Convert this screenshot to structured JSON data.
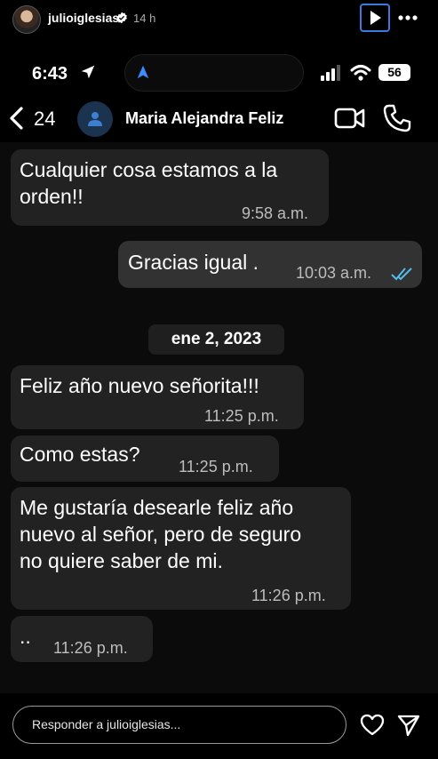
{
  "story": {
    "username": "julioiglesias",
    "time_ago": "14 h"
  },
  "status_bar": {
    "time": "6:43",
    "battery": "56"
  },
  "chat_header": {
    "unread_count": "24",
    "contact_name": "Maria Alejandra Feliz"
  },
  "messages": [
    {
      "text": "Cualquier cosa estamos a la\norden!!",
      "time": "9:58 a.m."
    },
    {
      "text": "Gracias igual .",
      "time": "10:03 a.m."
    },
    {
      "text": "Feliz año nuevo señorita!!!",
      "time": "11:25 p.m."
    },
    {
      "text": "Como estas?",
      "time": "11:25 p.m."
    },
    {
      "text": "Me gustaría desearle feliz año\nnuevo al señor, pero de seguro\nno quiere saber de mi.",
      "time": "11:26 p.m."
    },
    {
      "text": "..",
      "time": "11:26 p.m."
    }
  ],
  "date_separator": "ene 2, 2023",
  "reply_bar": {
    "placeholder": "Responder a julioiglesias..."
  },
  "colors": {
    "read_receipt": "#53bdeb",
    "play_border": "#3b7bdc"
  }
}
